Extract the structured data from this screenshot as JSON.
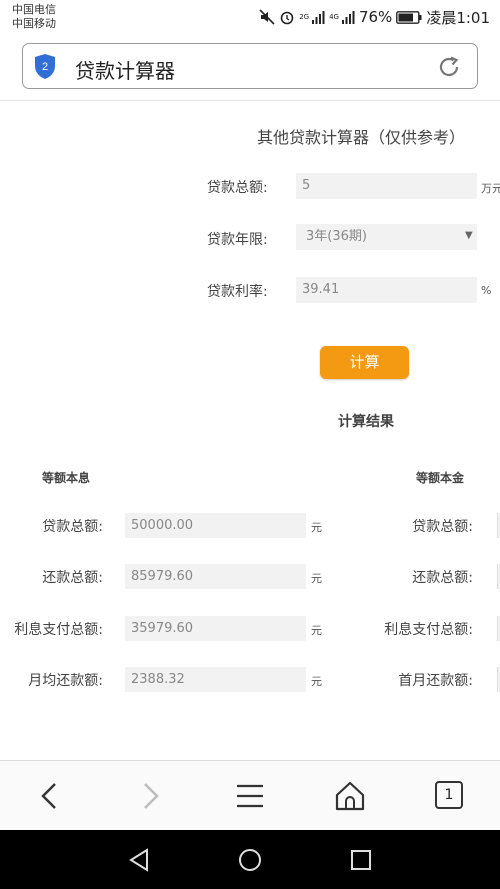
{
  "status_bar": {
    "carrier1": "中国电信",
    "carrier2": "中国移动",
    "net1": "2G",
    "net2": "4G",
    "battery": "76%",
    "time": "凌晨1:01",
    "icons": [
      "mute-icon",
      "alarm-icon",
      "signal-icon",
      "battery-icon"
    ]
  },
  "address_bar": {
    "title": "贷款计算器",
    "badge": "2",
    "shield_color": "#2f6fd6"
  },
  "calculator": {
    "heading": "其他贷款计算器（仅供参考）",
    "amount": {
      "label": "贷款总额:",
      "value": "5",
      "unit": "万元"
    },
    "term": {
      "label": "贷款年限:",
      "value": "3年(36期)"
    },
    "rate": {
      "label": "贷款利率:",
      "value": "39.41",
      "unit": "%"
    },
    "calc_button": "计算",
    "accent": "#f39a12"
  },
  "results": {
    "title": "计算结果",
    "equal_payment": {
      "heading": "等额本息",
      "rows": [
        {
          "label": "贷款总额:",
          "value": "50000.00",
          "unit": "元"
        },
        {
          "label": "还款总额:",
          "value": "85979.60",
          "unit": "元"
        },
        {
          "label": "利息支付总额:",
          "value": "35979.60",
          "unit": "元"
        },
        {
          "label": "月均还款额:",
          "value": "2388.32",
          "unit": "元"
        }
      ]
    },
    "equal_principal": {
      "heading": "等额本金",
      "rows": [
        {
          "label": "贷款总额:"
        },
        {
          "label": "还款总额:"
        },
        {
          "label": "利息支付总额:"
        },
        {
          "label": "首月还款额:"
        }
      ]
    }
  },
  "browser_toolbar": {
    "tab_count": "1"
  }
}
